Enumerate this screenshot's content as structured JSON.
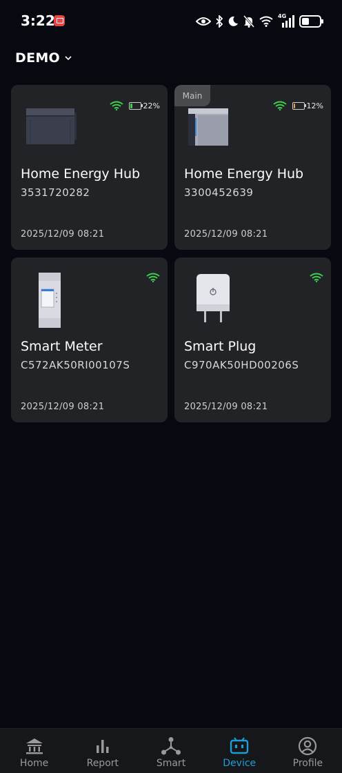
{
  "status_bar": {
    "time": "3:22",
    "network_label": "4G"
  },
  "header": {
    "title": "DEMO"
  },
  "devices": [
    {
      "name": "Home Energy Hub",
      "serial": "3531720282",
      "timestamp": "2025/12/09 08:21",
      "battery_percent": "22%",
      "battery_level": 0.22,
      "battery_color": "#3ccf4e",
      "wifi_color": "#3ccf4e",
      "is_main": false
    },
    {
      "name": "Home Energy Hub",
      "serial": "3300452639",
      "timestamp": "2025/12/09 08:21",
      "battery_percent": "12%",
      "battery_level": 0.12,
      "battery_color": "#e8a23a",
      "wifi_color": "#3ccf4e",
      "is_main": true,
      "main_label": "Main"
    },
    {
      "name": "Smart Meter",
      "serial": "C572AK50RI00107S",
      "timestamp": "2025/12/09 08:21",
      "wifi_color": "#3ccf4e"
    },
    {
      "name": "Smart Plug",
      "serial": "C970AK50HD00206S",
      "timestamp": "2025/12/09 08:21",
      "wifi_color": "#3ccf4e"
    }
  ],
  "nav": {
    "active": "Device",
    "active_color": "#1f9ed6",
    "items": [
      {
        "label": "Home",
        "icon": "home-icon"
      },
      {
        "label": "Report",
        "icon": "report-icon"
      },
      {
        "label": "Smart",
        "icon": "smart-icon"
      },
      {
        "label": "Device",
        "icon": "device-icon"
      },
      {
        "label": "Profile",
        "icon": "profile-icon"
      }
    ]
  }
}
